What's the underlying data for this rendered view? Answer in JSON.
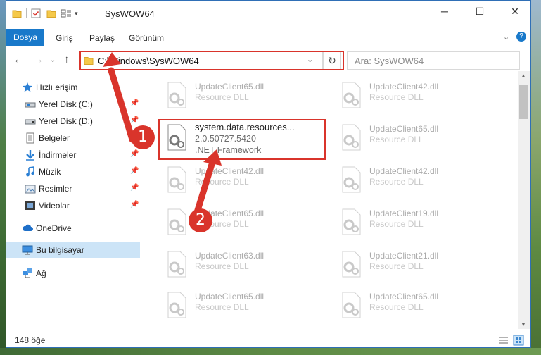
{
  "window": {
    "title": "SysWOW64"
  },
  "ribbon": {
    "tabs": [
      "Dosya",
      "Giriş",
      "Paylaş",
      "Görünüm"
    ]
  },
  "address": {
    "path": "C:\\Windows\\SysWOW64",
    "search_placeholder": "Ara: SysWOW64"
  },
  "sidebar": {
    "items": [
      {
        "label": "Hızlı erişim",
        "icon": "star-icon"
      },
      {
        "label": "Yerel Disk (C:)",
        "icon": "drive-icon"
      },
      {
        "label": "Yerel Disk (D:)",
        "icon": "drive-icon"
      },
      {
        "label": "Belgeler",
        "icon": "documents-icon"
      },
      {
        "label": "İndirmeler",
        "icon": "download-icon"
      },
      {
        "label": "Müzik",
        "icon": "music-icon"
      },
      {
        "label": "Resimler",
        "icon": "pictures-icon"
      },
      {
        "label": "Videolar",
        "icon": "video-icon"
      },
      {
        "label": "OneDrive",
        "icon": "cloud-icon"
      },
      {
        "label": "Bu bilgisayar",
        "icon": "computer-icon"
      },
      {
        "label": "Ağ",
        "icon": "network-icon"
      }
    ]
  },
  "files": [
    {
      "name": "UpdateClient65.dll",
      "type": "Resource DLL"
    },
    {
      "name": "UpdateClient42.dll",
      "type": "Resource DLL"
    },
    {
      "name": "system.data.resources...",
      "version": "2.0.50727.5420",
      "type": ".NET Framework"
    },
    {
      "name": "UpdateClient65.dll",
      "type": "Resource DLL"
    },
    {
      "name": "UpdateClient42.dll",
      "type": "Resource DLL"
    },
    {
      "name": "UpdateClient42.dll",
      "type": "Resource DLL"
    },
    {
      "name": "UpdateClient65.dll",
      "type": "Resource DLL"
    },
    {
      "name": "UpdateClient19.dll",
      "type": "Resource DLL"
    },
    {
      "name": "UpdateClient63.dll",
      "type": "Resource DLL"
    },
    {
      "name": "UpdateClient21.dll",
      "type": "Resource DLL"
    },
    {
      "name": "UpdateClient65.dll",
      "type": "Resource DLL"
    },
    {
      "name": "UpdateClient65.dll",
      "type": "Resource DLL"
    }
  ],
  "status": {
    "count": "148 öğe"
  },
  "annotations": {
    "step1": "1",
    "step2": "2"
  },
  "colors": {
    "accent": "#1979ca",
    "highlight": "#d9342b",
    "selected": "#cce4f7"
  }
}
